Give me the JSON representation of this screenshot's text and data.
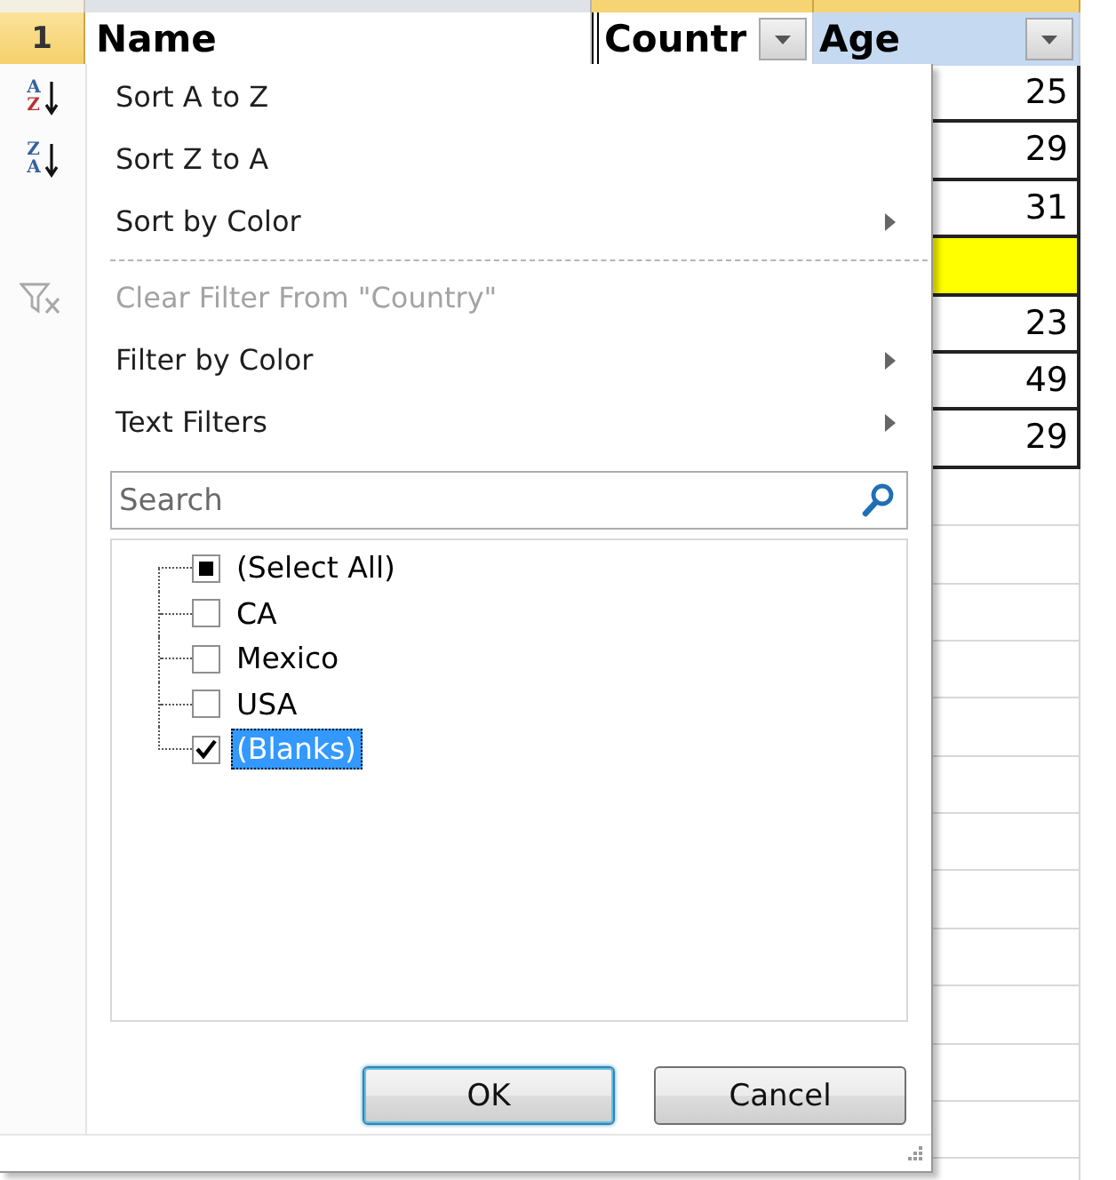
{
  "sheet": {
    "column_headers": [
      {
        "selected": false
      },
      {
        "selected": true
      },
      {
        "selected": true
      }
    ],
    "row_header": {
      "label": "1",
      "selected": true
    },
    "header_cells": [
      {
        "kind": "text",
        "text": "Name",
        "color": "#ffffff"
      },
      {
        "kind": "filter",
        "text": "Countr",
        "color": "#ffffff"
      },
      {
        "kind": "filter",
        "text": "Age",
        "color": "#c5d9f1"
      }
    ],
    "age_cells": [
      {
        "text": "25"
      },
      {
        "text": "29"
      },
      {
        "text": "31"
      },
      {
        "color": "#ffff00"
      },
      {
        "text": "23"
      },
      {
        "text": "49"
      },
      {
        "text": "29"
      }
    ]
  },
  "filter_menu": {
    "items": [
      {
        "kind": "ascending",
        "glyphs": [
          "A",
          "Z"
        ],
        "label": "Sort A to Z",
        "disabled": false
      },
      {
        "kind": "descending",
        "glyphs": [
          "Z",
          "A"
        ],
        "label": "Sort Z to A",
        "disabled": false
      },
      {
        "kind": "submenu",
        "label": "Sort by Color",
        "disabled": false
      },
      {
        "kind": "separator"
      },
      {
        "kind": "clear",
        "label": "Clear Filter From \"Country\"",
        "disabled": true
      },
      {
        "kind": "submenu",
        "label": "Filter by Color",
        "disabled": false
      },
      {
        "kind": "submenu",
        "label": "Text Filters",
        "disabled": false
      }
    ],
    "search": {
      "placeholder": "Search"
    },
    "values": [
      {
        "label": "(Select All)",
        "checked": false,
        "indeterminate": true,
        "selected": false
      },
      {
        "label": "CA",
        "checked": false,
        "indeterminate": false,
        "selected": false
      },
      {
        "label": "Mexico",
        "checked": false,
        "indeterminate": false,
        "selected": false
      },
      {
        "label": "USA",
        "checked": false,
        "indeterminate": false,
        "selected": false
      },
      {
        "label": "(Blanks)",
        "checked": true,
        "indeterminate": false,
        "selected": true
      }
    ],
    "buttons": [
      {
        "label": "OK",
        "default": true
      },
      {
        "label": "Cancel",
        "default": false
      }
    ]
  }
}
